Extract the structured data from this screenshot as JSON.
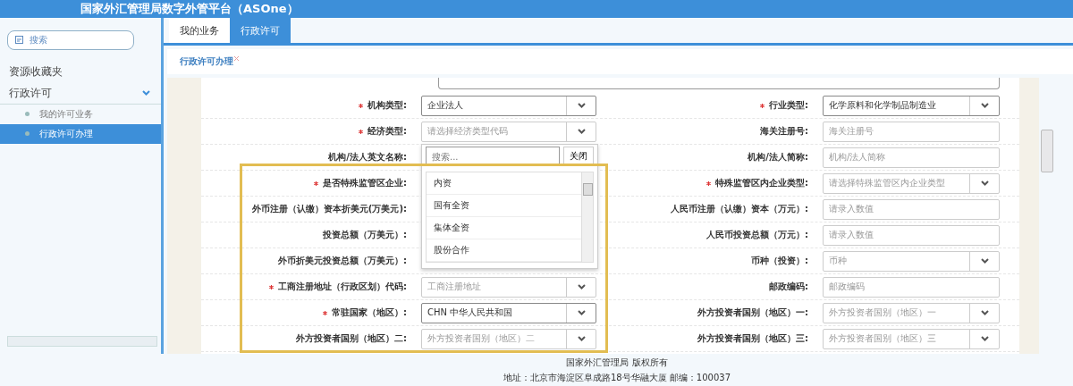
{
  "header": {
    "title": "国家外汇管理局数字外管平台（ASOne）"
  },
  "sidebar": {
    "search_button": "搜索",
    "sections": [
      {
        "label": "资源收藏夹"
      },
      {
        "label": "行政许可",
        "expanded": true,
        "children": [
          {
            "label": "我的许可业务",
            "selected": false
          },
          {
            "label": "行政许可办理",
            "selected": true
          }
        ]
      }
    ]
  },
  "tabs": [
    {
      "label": "我的业务",
      "selected": false
    },
    {
      "label": "行政许可",
      "selected": true
    }
  ],
  "subtab": {
    "label": "行政许可办理"
  },
  "form": {
    "rows": [
      [
        {
          "label": "机构类型:",
          "required": true,
          "kind": "select",
          "value": "企业法人"
        },
        {
          "label": "行业类型:",
          "required": true,
          "kind": "select",
          "value": "化学原料和化学制品制造业"
        }
      ],
      [
        {
          "label": "经济类型:",
          "required": true,
          "kind": "select",
          "placeholder": "请选择经济类型代码"
        },
        {
          "label": "海关注册号:",
          "required": false,
          "kind": "text",
          "placeholder": "海关注册号"
        }
      ],
      [
        {
          "label": "机构/法人英文名称:",
          "required": false,
          "kind": "none"
        },
        {
          "label": "机构/法人简称:",
          "required": false,
          "kind": "text",
          "placeholder": "机构/法人简称"
        }
      ],
      [
        {
          "label": "是否特殊监管区企业:",
          "required": true,
          "kind": "none"
        },
        {
          "label": "特殊监管区内企业类型:",
          "required": true,
          "kind": "select",
          "placeholder": "请选择特殊监管区内企业类型"
        }
      ],
      [
        {
          "label": "外币注册（认缴）资本折美元(万美元):",
          "required": false,
          "kind": "none"
        },
        {
          "label": "人民币注册（认缴）资本（万元）:",
          "required": false,
          "kind": "text",
          "placeholder": "请录入数值"
        }
      ],
      [
        {
          "label": "投资总额（万美元）:",
          "required": false,
          "kind": "none"
        },
        {
          "label": "人民币投资总额（万元）:",
          "required": false,
          "kind": "text",
          "placeholder": "请录入数值"
        }
      ],
      [
        {
          "label": "外币折美元投资总额（万美元）:",
          "required": false,
          "kind": "none"
        },
        {
          "label": "币种（投资）:",
          "required": false,
          "kind": "select",
          "placeholder": "币种"
        }
      ],
      [
        {
          "label": "工商注册地址（行政区划）代码:",
          "required": true,
          "kind": "select",
          "placeholder": "工商注册地址"
        },
        {
          "label": "邮政编码:",
          "required": false,
          "kind": "text",
          "placeholder": "邮政编码"
        }
      ],
      [
        {
          "label": "常驻国家（地区）:",
          "required": true,
          "kind": "select",
          "value": "CHN  中华人民共和国"
        },
        {
          "label": "外方投资者国别（地区）一:",
          "required": false,
          "kind": "select",
          "placeholder": "外方投资者国别（地区）一"
        }
      ],
      [
        {
          "label": "外方投资者国别（地区）二:",
          "required": false,
          "kind": "select",
          "placeholder": "外方投资者国别（地区）二"
        },
        {
          "label": "外方投资者国别（地区）三:",
          "required": false,
          "kind": "select",
          "placeholder": "外方投资者国别（地区）三"
        }
      ]
    ]
  },
  "dropdown": {
    "search_placeholder": "搜索...",
    "close_button": "关闭",
    "options": [
      "内资",
      "国有全资",
      "集体全资",
      "股份合作"
    ]
  },
  "footer": {
    "lines": [
      "国家外汇管理局 版权所有",
      "地址：北京市海淀区阜成路18号华融大厦 邮编：100037"
    ]
  }
}
